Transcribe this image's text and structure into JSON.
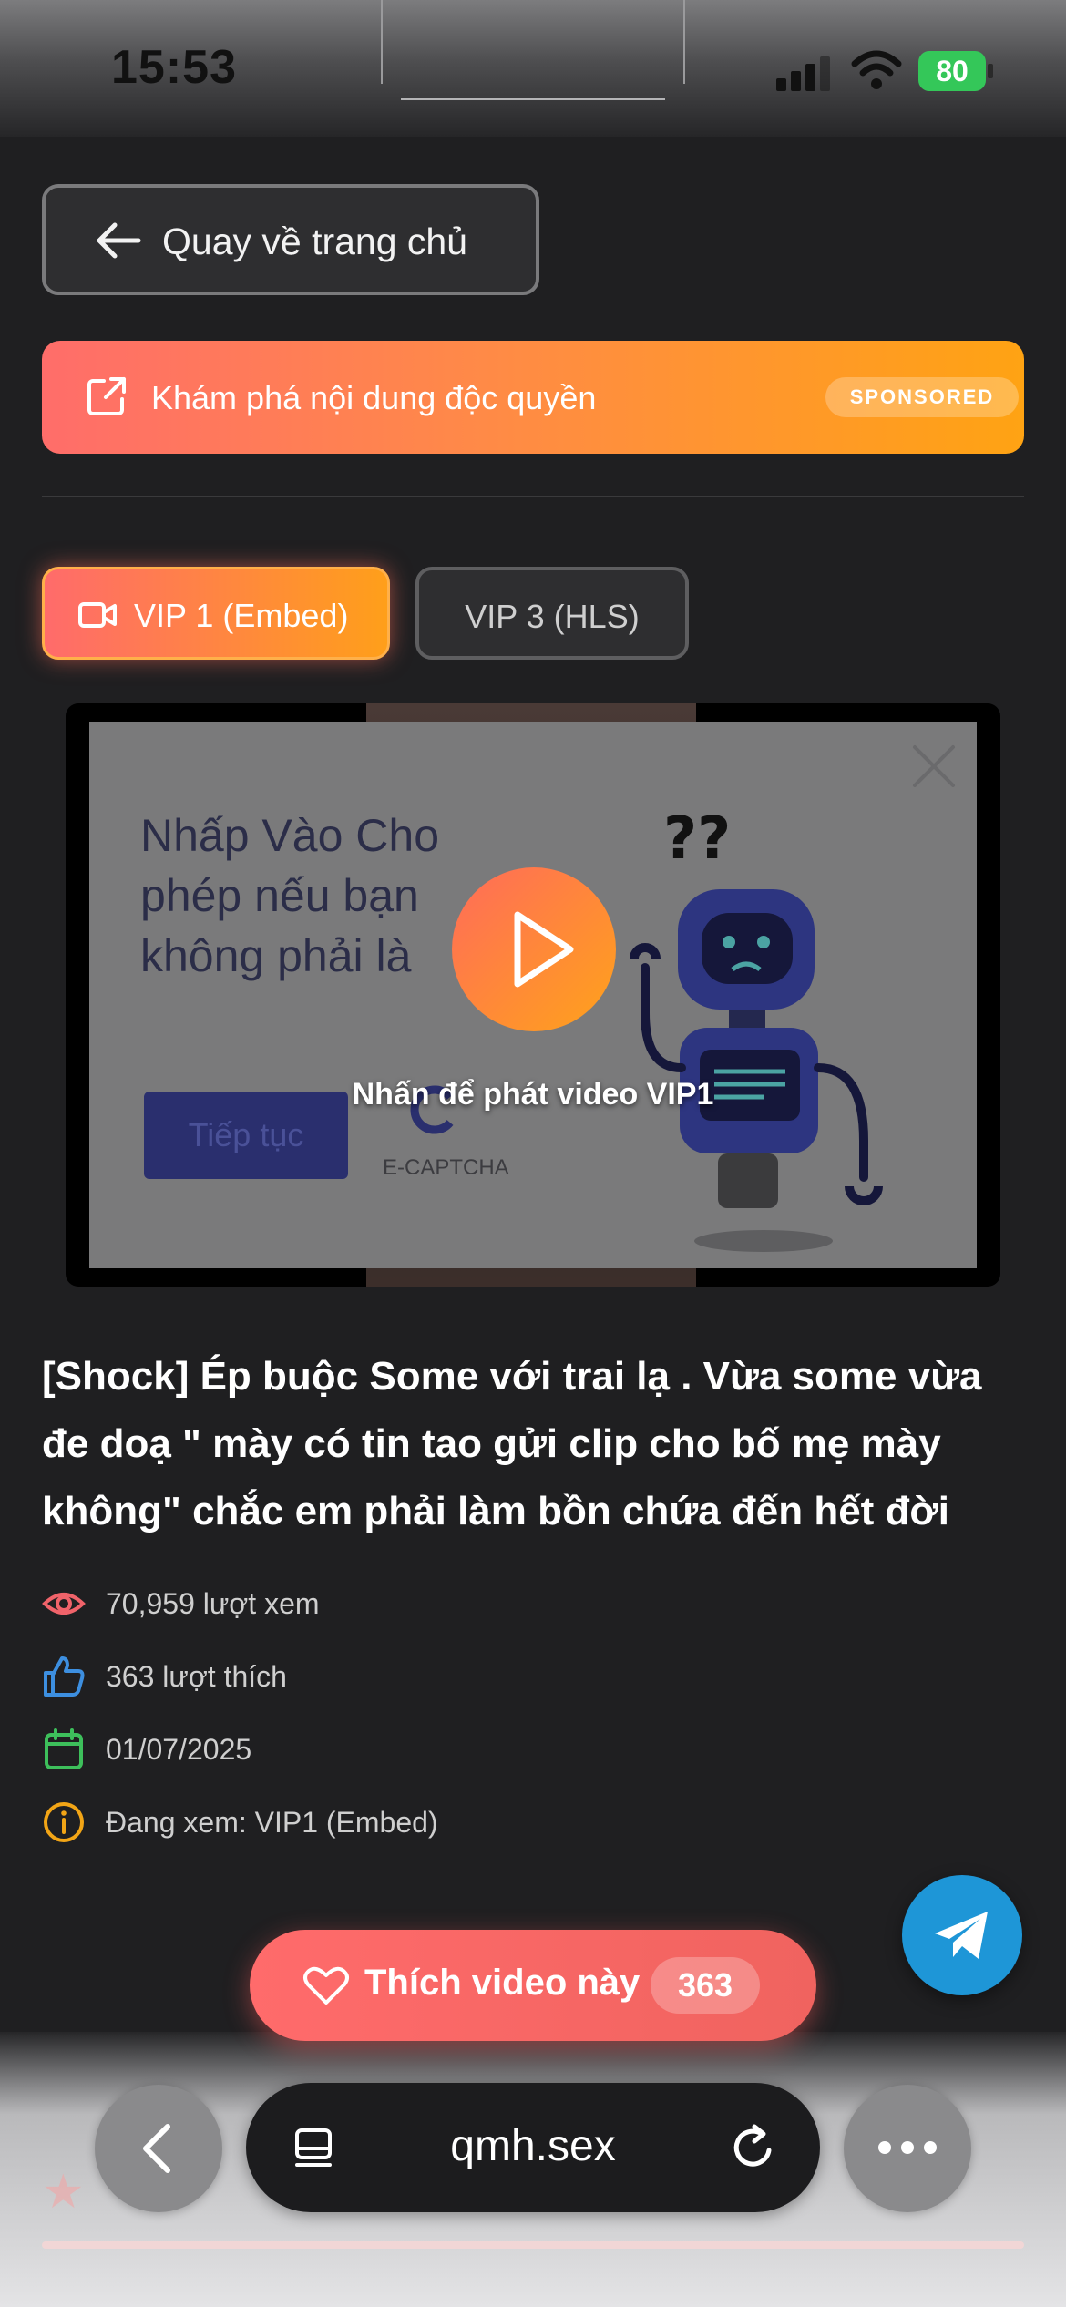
{
  "status_bar": {
    "time": "15:53",
    "battery": "80"
  },
  "back": {
    "label": "Quay về trang chủ"
  },
  "sponsor": {
    "text": "Khám phá nội dung độc quyền",
    "badge": "SPONSORED"
  },
  "servers": [
    {
      "label": "VIP 1 (Embed)",
      "active": true
    },
    {
      "label": "VIP 3 (HLS)",
      "active": false
    }
  ],
  "player": {
    "ad_text": "Nhấp Vào Cho phép nếu bạn không phải là",
    "ad_button": "Tiếp tục",
    "ad_captcha": "E-CAPTCHA",
    "play_caption": "Nhấn để phát video VIP1"
  },
  "video": {
    "title": "[Shock] Ép buộc Some với trai lạ . Vừa some vừa đe doạ \" mày có tin tao gửi clip cho bố mẹ mày không\" chắc em phải làm bồn chứa đến hết đời",
    "views": "70,959 lượt xem",
    "likes": "363 lượt thích",
    "date": "01/07/2025",
    "watching": "Đang xem: VIP1 (Embed)"
  },
  "like_button": {
    "label": "Thích video này",
    "count": "363"
  },
  "browser": {
    "url": "qmh.sex"
  },
  "colors": {
    "accent_start": "#ff6b6b",
    "accent_end": "#ffa31a",
    "telegram": "#1e96d7",
    "battery": "#34c759"
  },
  "icons": [
    "arrow-left-icon",
    "external-link-icon",
    "video-camera-icon",
    "play-icon",
    "eye-icon",
    "thumbs-up-icon",
    "calendar-icon",
    "info-icon",
    "heart-icon",
    "telegram-icon",
    "chevron-left-icon",
    "tabs-icon",
    "reload-icon",
    "more-icon"
  ]
}
